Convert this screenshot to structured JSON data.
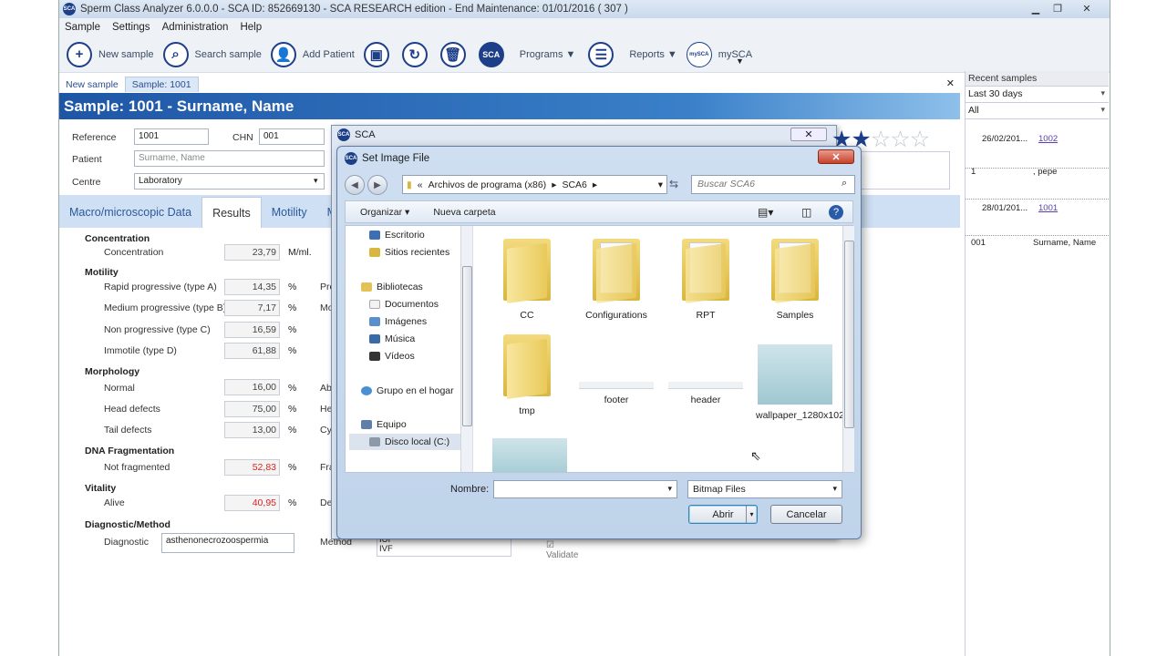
{
  "window": {
    "title": "Sperm Class Analyzer 6.0.0.0 - SCA ID: 852669130 - SCA RESEARCH edition - End Maintenance: 01/01/2016 ( 307 )",
    "app_icon": "SCA"
  },
  "menu": [
    "Sample",
    "Settings",
    "Administration",
    "Help"
  ],
  "toolbar": {
    "new_sample": "New sample",
    "search_sample": "Search sample",
    "add_patient": "Add Patient",
    "sca_logo": "SCA",
    "programs": "Programs",
    "reports": "Reports",
    "mysca_logo": "mySCA",
    "mysca": "mySCA"
  },
  "doc_tabs": [
    "New sample",
    "Sample: 1001"
  ],
  "banner": "Sample: 1001 - Surname, Name",
  "form": {
    "reference_label": "Reference",
    "reference_value": "1001",
    "chn_label": "CHN",
    "chn_value": "001",
    "patient_label": "Patient",
    "patient_value": "Surname, Name",
    "centre_label": "Centre",
    "centre_value": "Laboratory"
  },
  "section_tabs": [
    "Macro/microscopic Data",
    "Results",
    "Motility",
    "Motil"
  ],
  "results": {
    "concentration_header": "Concentration",
    "concentration_label": "Concentration",
    "concentration_value": "23,79",
    "concentration_unit": "M/ml.",
    "motility_header": "Motility",
    "rapid_label": "Rapid progressive (type A)",
    "rapid_value": "14,35",
    "medium_label": "Medium progressive (type B)",
    "medium_value": "7,17",
    "nonprog_label": "Non progressive (type C)",
    "nonprog_value": "16,59",
    "immotile_label": "Immotile (type D)",
    "immotile_value": "61,88",
    "morphology_header": "Morphology",
    "normal_label": "Normal",
    "normal_value": "16,00",
    "head_label": "Head defects",
    "head_value": "75,00",
    "tail_label": "Tail defects",
    "tail_value": "13,00",
    "dna_header": "DNA Fragmentation",
    "notfrag_label": "Not fragmented",
    "notfrag_value": "52,83",
    "vitality_header": "Vitality",
    "alive_label": "Alive",
    "alive_value": "40,95",
    "diag_header": "Diagnostic/Method",
    "diagnostic_label": "Diagnostic",
    "diagnostic_value": "asthenonecrozoospermia",
    "method_label": "Method",
    "method_value_1": "IUI",
    "method_value_2": "IVF",
    "validate_label": "Validate",
    "percent": "%",
    "col_pro": "Pro",
    "col_mo": "Mo",
    "col_ab": "Ab",
    "col_he": "He",
    "col_cy": "Cy",
    "col_fra": "Fra",
    "col_de": "De"
  },
  "recent": {
    "header": "Recent samples",
    "filter1": "Last 30 days",
    "filter2": "All",
    "rows": [
      {
        "date": "26/02/201...",
        "id": "1002",
        "c2": "1",
        "name": ", pepe"
      },
      {
        "date": "28/01/201...",
        "id": "1001",
        "c2": "001",
        "name": "Surname, Name"
      }
    ]
  },
  "sca_dialog": {
    "title": "SCA",
    "stars_filled": 2,
    "stars_total": 5
  },
  "file_dialog": {
    "title": "Set Image File",
    "path": [
      "«",
      "Archivos de programa (x86)",
      "SCA6"
    ],
    "search_placeholder": "Buscar SCA6",
    "organize": "Organizar",
    "new_folder": "Nueva carpeta",
    "tree": [
      "Escritorio",
      "Sitios recientes",
      "Bibliotecas",
      "Documentos",
      "Imágenes",
      "Música",
      "Vídeos",
      "Grupo en el hogar",
      "Equipo",
      "Disco local (C:)"
    ],
    "files": [
      "CC",
      "Configurations",
      "RPT",
      "Samples",
      "tmp",
      "footer",
      "header",
      "wallpaper_1280x1024"
    ],
    "name_label": "Nombre:",
    "name_value": "",
    "filetype": "Bitmap Files",
    "open": "Abrir",
    "cancel": "Cancelar"
  }
}
